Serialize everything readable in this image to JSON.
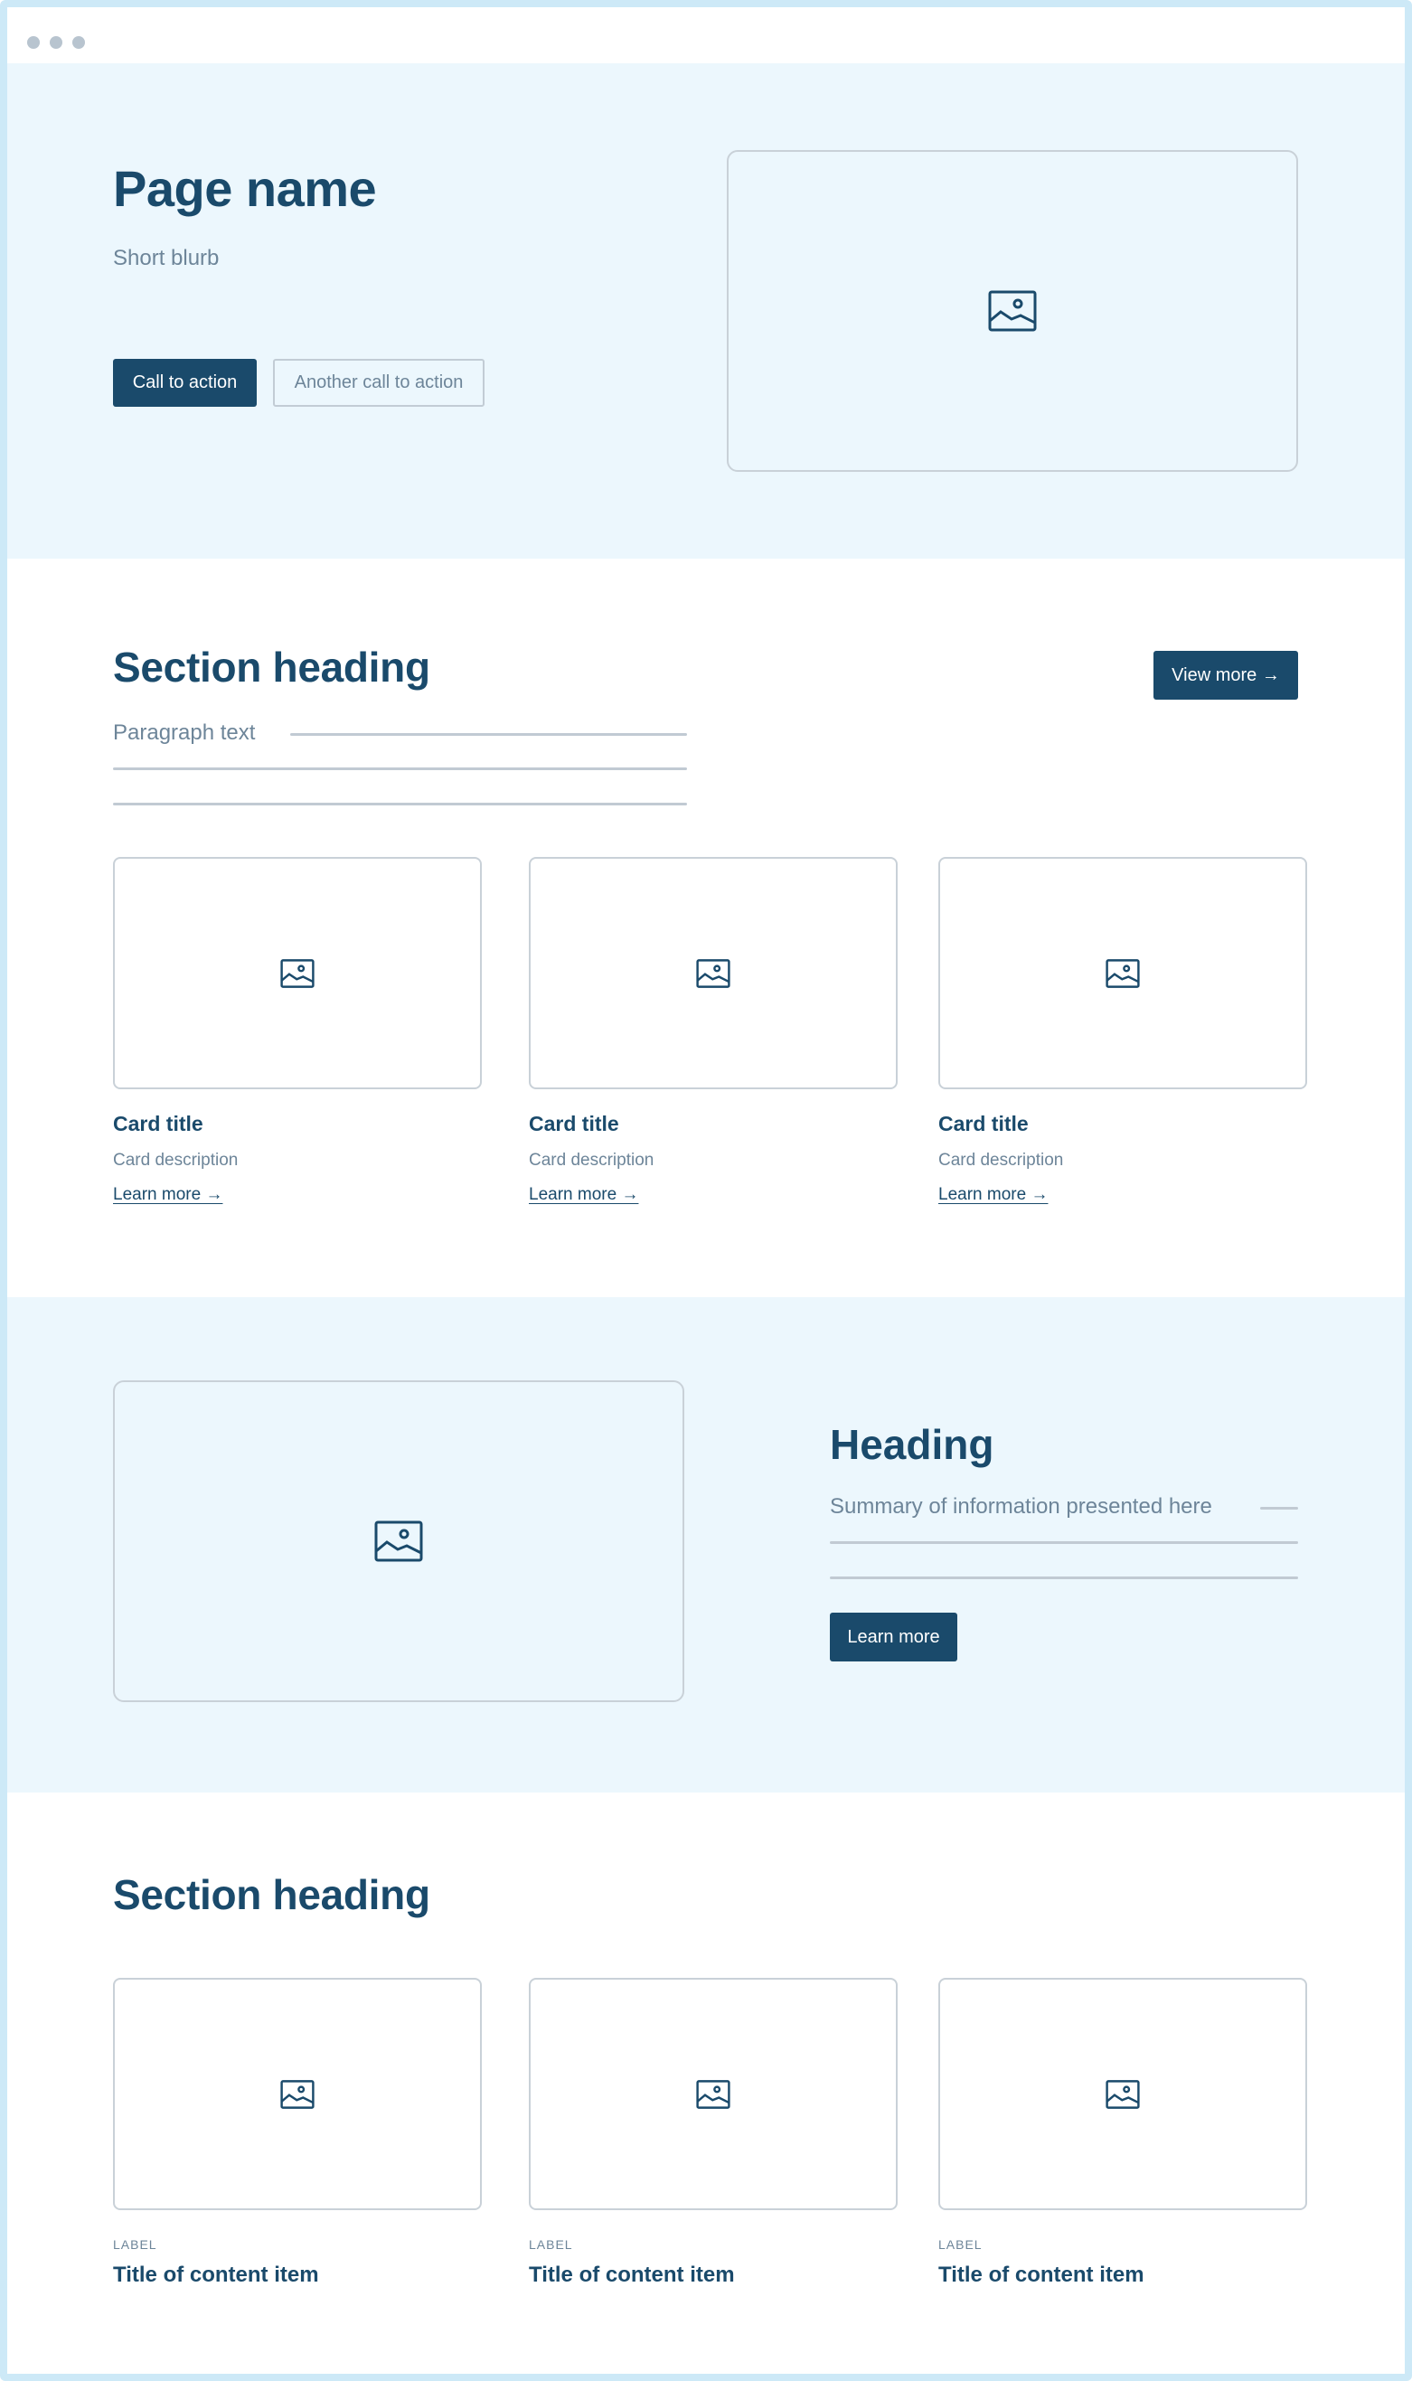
{
  "hero": {
    "title": "Page name",
    "blurb": "Short blurb",
    "cta_primary": "Call to action",
    "cta_secondary": "Another call to action",
    "image_icon": "image-icon"
  },
  "section1": {
    "heading": "Section heading",
    "view_more": "View more →",
    "paragraph": "Paragraph text",
    "cards": [
      {
        "title": "Card title",
        "description": "Card description",
        "link": "Learn more →"
      },
      {
        "title": "Card title",
        "description": "Card description",
        "link": "Learn more →"
      },
      {
        "title": "Card title",
        "description": "Card description",
        "link": "Learn more →"
      }
    ]
  },
  "feature": {
    "heading": "Heading",
    "summary": "Summary of information presented here",
    "button": "Learn more"
  },
  "section2": {
    "heading": "Section heading",
    "items": [
      {
        "label": "LABEL",
        "title": "Title of content item"
      },
      {
        "label": "LABEL",
        "title": "Title of content item"
      },
      {
        "label": "LABEL",
        "title": "Title of content item"
      }
    ]
  },
  "colors": {
    "primary": "#1a4a6b",
    "light_bg": "#ecf7fd",
    "muted_text": "#6d8599",
    "frame_border": "#cde9f7"
  }
}
